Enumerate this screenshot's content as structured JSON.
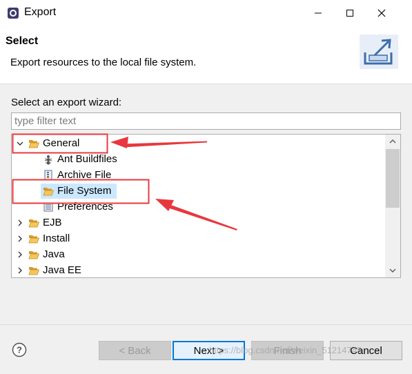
{
  "window": {
    "title": "Export"
  },
  "banner": {
    "title": "Select",
    "description": "Export resources to the local file system."
  },
  "wizard": {
    "label": "Select an export wizard:",
    "filter_placeholder": "type filter text",
    "filter_value": ""
  },
  "tree": {
    "general": {
      "label": "General",
      "expanded": true,
      "icon": "folder-open-icon"
    },
    "children": [
      {
        "label": "Ant Buildfiles",
        "icon": "ant-icon"
      },
      {
        "label": "Archive File",
        "icon": "archive-icon"
      },
      {
        "label": "File System",
        "icon": "folder-open-icon",
        "selected": true
      },
      {
        "label": "Preferences",
        "icon": "preferences-icon"
      }
    ],
    "roots": [
      {
        "label": "EJB",
        "icon": "folder-open-icon"
      },
      {
        "label": "Install",
        "icon": "folder-open-icon"
      },
      {
        "label": "Java",
        "icon": "folder-open-icon"
      },
      {
        "label": "Java EE",
        "icon": "folder-open-icon"
      }
    ]
  },
  "buttons": {
    "back": "< Back",
    "next": "Next >",
    "finish": "Finish",
    "cancel": "Cancel"
  },
  "watermark": "https://blog.csdn.net/weixin_51214745",
  "colors": {
    "selection": "#cce8ff",
    "annotation": "#e8383d",
    "default_button_border": "#0078d7",
    "folder": "#e8a93b"
  }
}
